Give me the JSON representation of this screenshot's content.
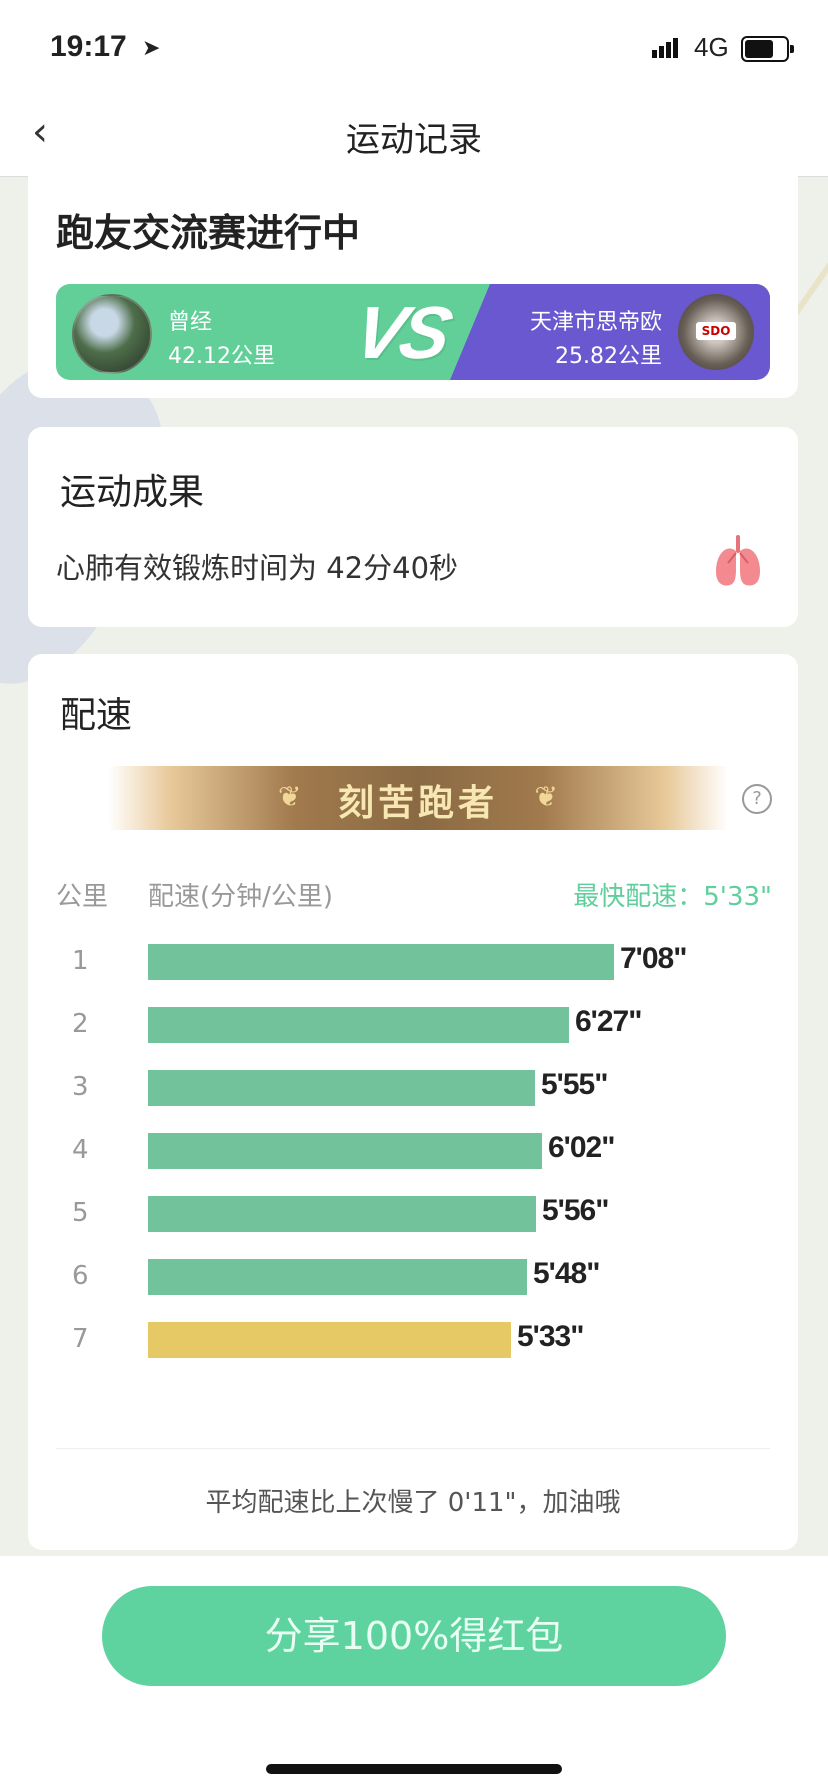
{
  "status_bar": {
    "time": "19:17",
    "network": "4G"
  },
  "nav": {
    "title": "运动记录"
  },
  "race": {
    "heading": "跑友交流赛进行中",
    "vs": "VS",
    "player1": {
      "name": "曾经",
      "distance": "42.12公里"
    },
    "player2": {
      "name": "天津市思帝欧",
      "distance": "25.82公里"
    }
  },
  "result": {
    "heading": "运动成果",
    "desc": "心肺有效锻炼时间为 42分40秒"
  },
  "pace": {
    "heading": "配速",
    "badge": "刻苦跑者",
    "col_km": "公里",
    "col_pace": "配速(分钟/公里)",
    "fastest": "最快配速：5'33\"",
    "splits": [
      {
        "km": "1",
        "pace": "7'08\"",
        "seconds": 428
      },
      {
        "km": "2",
        "pace": "6'27\"",
        "seconds": 387
      },
      {
        "km": "3",
        "pace": "5'55\"",
        "seconds": 355
      },
      {
        "km": "4",
        "pace": "6'02\"",
        "seconds": 362
      },
      {
        "km": "5",
        "pace": "5'56\"",
        "seconds": 356
      },
      {
        "km": "6",
        "pace": "5'48\"",
        "seconds": 348
      },
      {
        "km": "7",
        "pace": "5'33\"",
        "seconds": 333
      }
    ],
    "fastest_km": "7",
    "avg_note": "平均配速比上次慢了 0'11\"，加油哦"
  },
  "share_button": "分享100%得红包",
  "colors": {
    "green": "#72c39c",
    "gold": "#e6c865",
    "purple": "#6958d0",
    "accent": "#5fd39f"
  }
}
